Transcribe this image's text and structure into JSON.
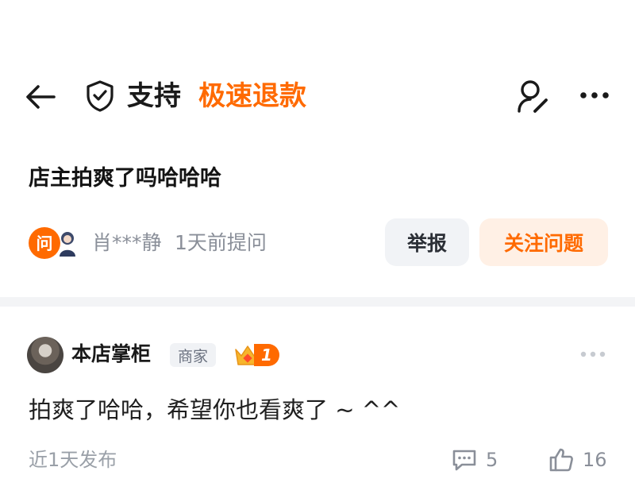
{
  "header": {
    "support_label": "支持",
    "refund_label": "极速退款",
    "icons": [
      "back-arrow-icon",
      "shield-check-icon",
      "user-edit-icon",
      "more-icon"
    ],
    "accent_color": "#ff6a00"
  },
  "question": {
    "title": "店主拍爽了吗哈哈哈",
    "badge_char": "问",
    "asker": "肖***静",
    "asked_time": "1天前提问",
    "report_label": "举报",
    "follow_label": "关注问题"
  },
  "answer": {
    "author": "本店掌柜",
    "author_tag": "商家",
    "rank_number": "1",
    "content": "拍爽了哈哈，希望你也看爽了 ~ ^^",
    "time": "近1天发布",
    "comment_count": "5",
    "like_count": "16"
  }
}
